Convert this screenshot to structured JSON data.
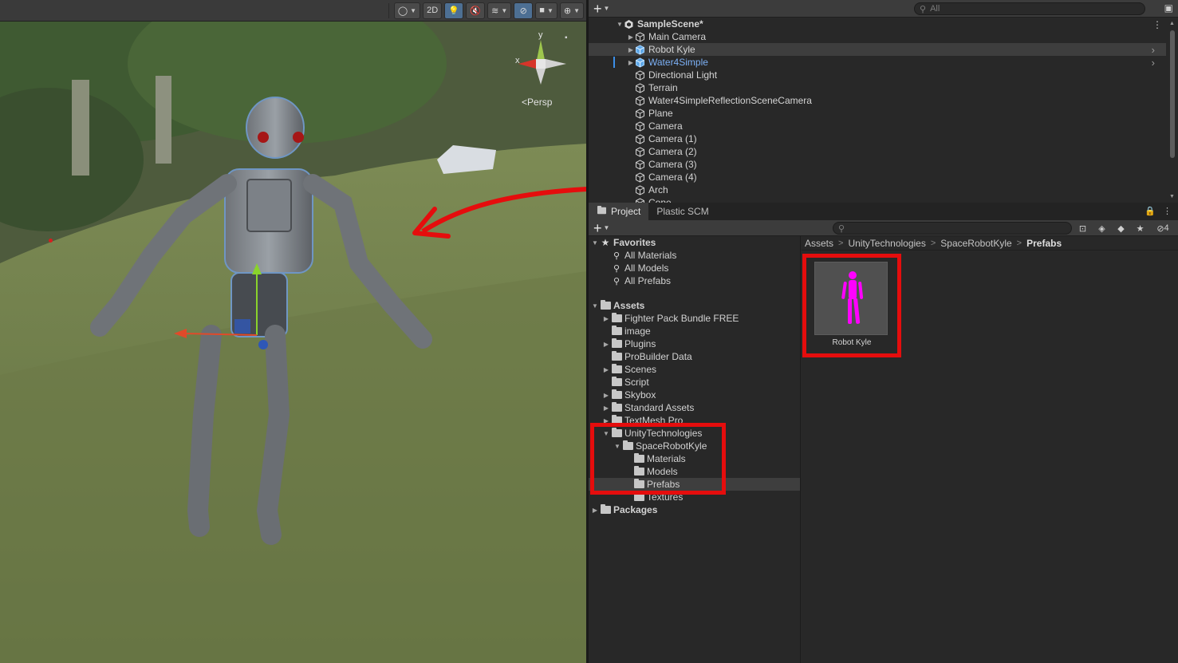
{
  "scene_view": {
    "toolbar": {
      "mode_2d_label": "2D"
    },
    "gizmo": {
      "axis_y": "y",
      "axis_x": "x",
      "projection_label": "Persp"
    }
  },
  "hierarchy": {
    "search_placeholder": "All",
    "scene_name": "SampleScene*",
    "items": [
      {
        "label": "Main Camera",
        "expandable": true
      },
      {
        "label": "Robot Kyle",
        "expandable": true,
        "selected": true,
        "prefab": true
      },
      {
        "label": "Water4Simple",
        "expandable": true,
        "prefab": true
      },
      {
        "label": "Directional Light"
      },
      {
        "label": "Terrain"
      },
      {
        "label": "Water4SimpleReflectionSceneCamera"
      },
      {
        "label": "Plane"
      },
      {
        "label": "Camera"
      },
      {
        "label": "Camera (1)"
      },
      {
        "label": "Camera (2)"
      },
      {
        "label": "Camera (3)"
      },
      {
        "label": "Camera (4)"
      },
      {
        "label": "Arch"
      },
      {
        "label": "Cone"
      }
    ]
  },
  "project": {
    "tabs": [
      "Project",
      "Plastic SCM"
    ],
    "hidden_count": "4",
    "favorites": {
      "label": "Favorites",
      "items": [
        "All Materials",
        "All Models",
        "All Prefabs"
      ]
    },
    "assets": {
      "label": "Assets",
      "items": [
        "Fighter Pack Bundle FREE",
        "image",
        "Plugins",
        "ProBuilder Data",
        "Scenes",
        "Script",
        "Skybox",
        "Standard Assets",
        "TextMesh Pro",
        "UnityTechnologies"
      ],
      "unity_children": {
        "label": "SpaceRobotKyle",
        "items": [
          "Materials",
          "Models",
          "Prefabs",
          "Textures"
        ]
      }
    },
    "packages_label": "Packages",
    "breadcrumb": [
      "Assets",
      "UnityTechnologies",
      "SpaceRobotKyle",
      "Prefabs"
    ],
    "grid_items": [
      {
        "label": "Robot Kyle"
      }
    ]
  },
  "colors": {
    "annotation_red": "#e50d0d",
    "prefab_blue": "#7cb0f5",
    "thumbnail_magenta": "#ff00ff"
  }
}
